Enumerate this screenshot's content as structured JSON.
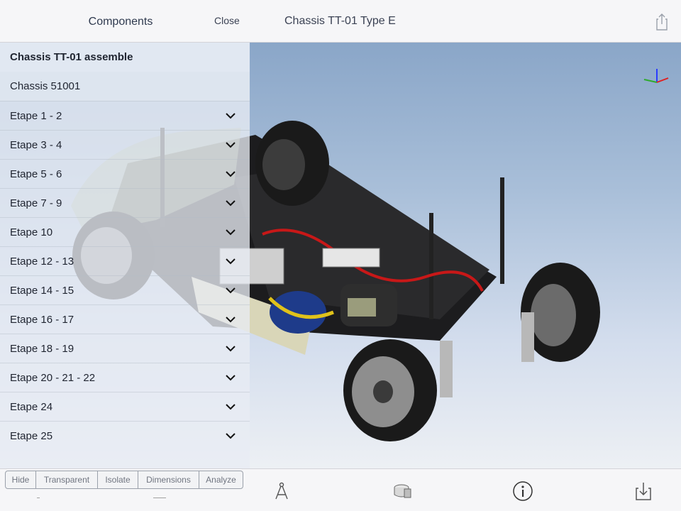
{
  "header": {
    "panel_title": "Components",
    "close_label": "Close",
    "document_title": "Chassis TT-01 Type E",
    "share_icon": "share-icon"
  },
  "tree": {
    "root_label": "Chassis TT-01 assemble",
    "items": [
      {
        "label": "Chassis 51001",
        "expandable": false
      },
      {
        "label": "Etape 1 - 2",
        "expandable": true
      },
      {
        "label": "Etape 3 - 4",
        "expandable": true
      },
      {
        "label": "Etape 5 - 6",
        "expandable": true
      },
      {
        "label": "Etape 7 - 9",
        "expandable": true
      },
      {
        "label": "Etape 10",
        "expandable": true
      },
      {
        "label": "Etape 12 - 13",
        "expandable": true
      },
      {
        "label": "Etape 14 - 15",
        "expandable": true
      },
      {
        "label": "Etape 16 - 17",
        "expandable": true
      },
      {
        "label": "Etape 18 - 19",
        "expandable": true
      },
      {
        "label": "Etape 20 - 21 - 22",
        "expandable": true
      },
      {
        "label": "Etape 24",
        "expandable": true
      },
      {
        "label": "Etape 25",
        "expandable": true
      }
    ]
  },
  "actions": {
    "hide": "Hide",
    "transparent": "Transparent",
    "isolate": "Isolate",
    "dimensions": "Dimensions",
    "analyze": "Analyze"
  },
  "toolbar": {
    "icons": [
      "measure-compass-icon",
      "section-view-icon",
      "info-icon",
      "download-icon"
    ]
  },
  "colors": {
    "accent_text": "#2f3a4f",
    "viewport_top": "#8aa6c8",
    "viewport_bottom": "#edf0f4"
  }
}
